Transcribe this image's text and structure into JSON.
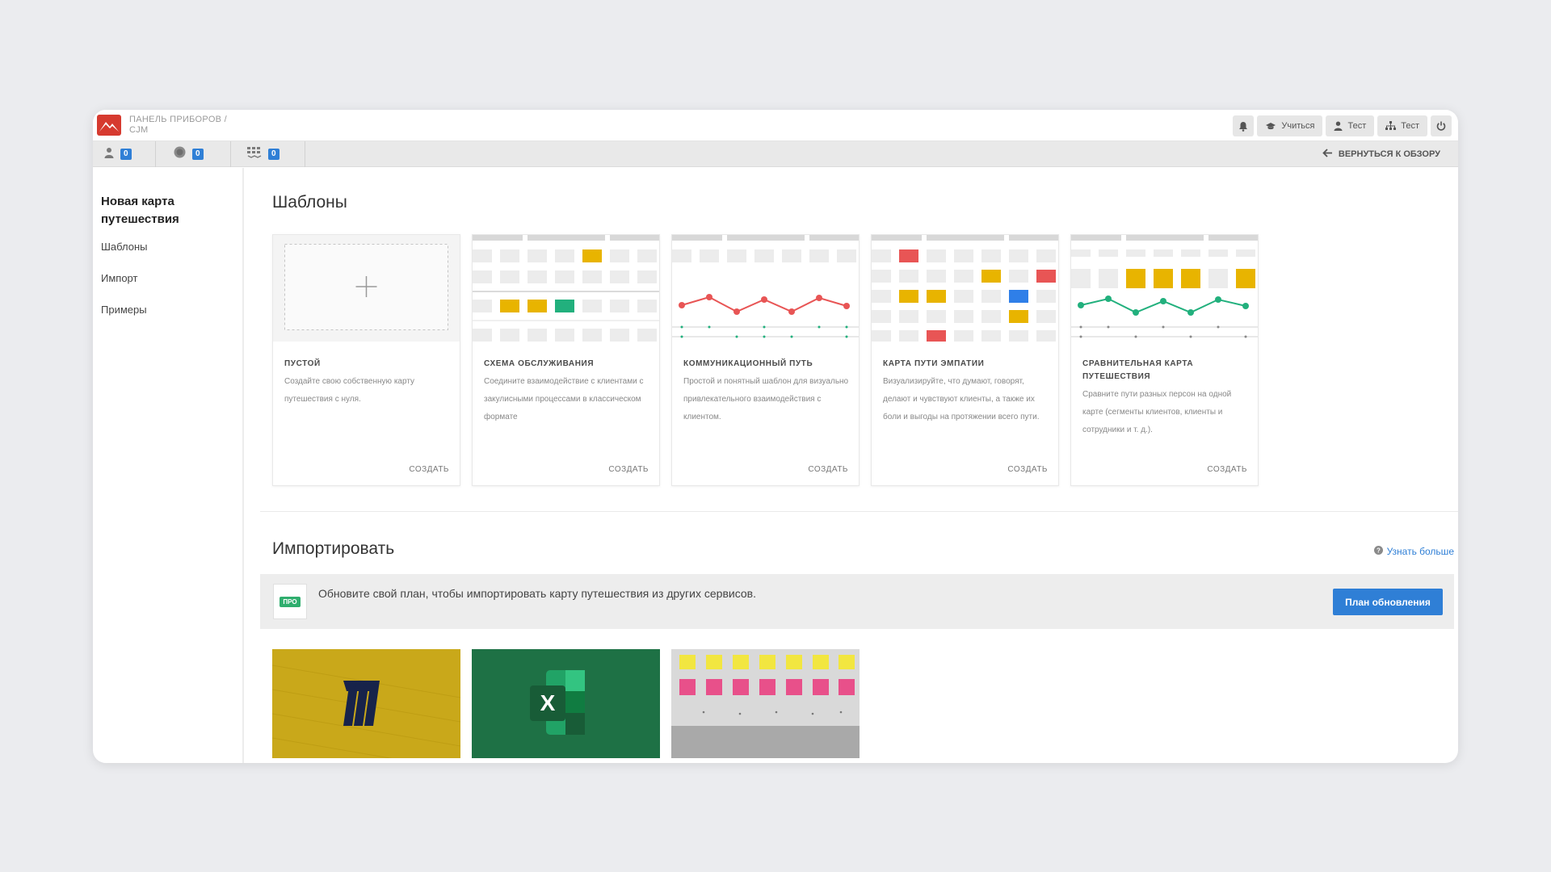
{
  "header": {
    "breadcrumb_line1": "ПАНЕЛЬ ПРИБОРОВ /",
    "breadcrumb_line2": "CJM",
    "actions": [
      {
        "label": "Учиться",
        "icon": "graduation-cap-icon"
      },
      {
        "label": "Тест",
        "icon": "user-icon"
      },
      {
        "label": "Тест",
        "icon": "sitemap-icon"
      }
    ]
  },
  "counters": [
    {
      "icon": "persona-icon",
      "value": "0"
    },
    {
      "icon": "circle-icon",
      "value": "0"
    },
    {
      "icon": "grid-icon",
      "value": "0"
    }
  ],
  "back_label": "ВЕРНУТЬСЯ К ОБЗОРУ",
  "sidebar": {
    "title": "Новая карта путешествия",
    "items": [
      "Шаблоны",
      "Импорт",
      "Примеры"
    ]
  },
  "templates": {
    "heading": "Шаблоны",
    "cards": [
      {
        "title": "ПУСТОЙ",
        "description": "Создайте свою собственную карту путешествия с нуля.",
        "action": "СОЗДАТЬ"
      },
      {
        "title": "СХЕМА ОБСЛУЖИВАНИЯ",
        "description": "Соедините взаимодействие с клиентами с закулисными процессами в классическом формате",
        "action": "СОЗДАТЬ"
      },
      {
        "title": "КОММУНИКАЦИОННЫЙ ПУТЬ",
        "description": "Простой и понятный шаблон для визуально привлекательного взаимодействия с клиентом.",
        "action": "СОЗДАТЬ"
      },
      {
        "title": "КАРТА ПУТИ ЭМПАТИИ",
        "description": "Визуализируйте, что думают, говорят, делают и чувствуют клиенты, а также их боли и выгоды на протяжении всего пути.",
        "action": "СОЗДАТЬ"
      },
      {
        "title": "СРАВНИТЕЛЬНАЯ КАРТА ПУТЕШЕСТВИЯ",
        "description": "Сравните пути разных персон на одной карте (сегменты клиентов, клиенты и сотрудники и т. д.).",
        "action": "СОЗДАТЬ"
      }
    ]
  },
  "import": {
    "heading": "Импортировать",
    "learn_more": "Узнать больше",
    "pro_badge": "ПРО",
    "upgrade_text": "Обновите свой план, чтобы импортировать карту путешествия из других сервисов.",
    "upgrade_button": "План обновления",
    "sources": [
      {
        "name": "miro-logo",
        "color": "#c9a81a"
      },
      {
        "name": "excel-logo",
        "color": "#1e7145"
      },
      {
        "name": "sticky-notes-photo",
        "color": "#bdbdbd"
      }
    ]
  },
  "colors": {
    "accent": "#2f7fd6",
    "yellow": "#e8b400",
    "red": "#e85555",
    "green": "#22b07d",
    "blue": "#2f7fe8"
  }
}
